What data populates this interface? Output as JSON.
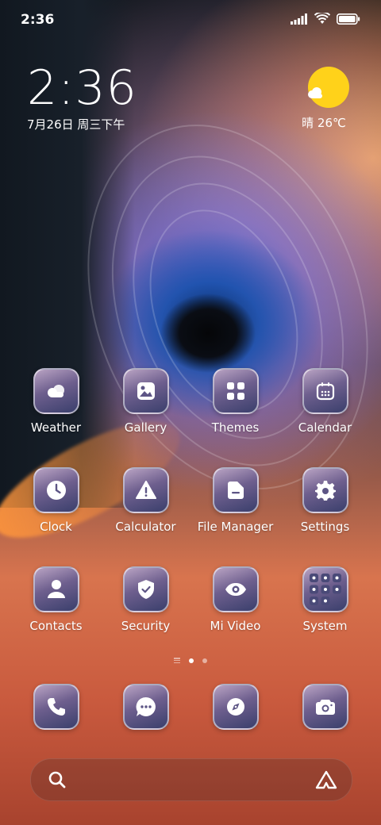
{
  "status_bar": {
    "time": "2:36",
    "icons": [
      "signal-icon",
      "wifi-icon",
      "battery-icon"
    ]
  },
  "clock_widget": {
    "time": "2:36",
    "date": "7月26日 周三下午"
  },
  "weather_widget": {
    "icon": "sun-cloud-icon",
    "text": "晴 26℃"
  },
  "apps": [
    {
      "label": "Weather",
      "icon": "weather-cloud-icon"
    },
    {
      "label": "Gallery",
      "icon": "gallery-icon"
    },
    {
      "label": "Themes",
      "icon": "themes-grid-icon"
    },
    {
      "label": "Calendar",
      "icon": "calendar-icon"
    },
    {
      "label": "Clock",
      "icon": "clock-icon"
    },
    {
      "label": "Calculator",
      "icon": "warning-triangle-icon"
    },
    {
      "label": "File Manager",
      "icon": "folder-icon"
    },
    {
      "label": "Settings",
      "icon": "gear-icon"
    },
    {
      "label": "Contacts",
      "icon": "contacts-icon"
    },
    {
      "label": "Security",
      "icon": "shield-check-icon"
    },
    {
      "label": "Mi Video",
      "icon": "eye-icon"
    },
    {
      "label": "System",
      "icon": "folder-grid-icon"
    }
  ],
  "pages": {
    "count": 2,
    "active": 1
  },
  "dock": [
    {
      "icon": "phone-icon"
    },
    {
      "icon": "message-icon"
    },
    {
      "icon": "compass-icon"
    },
    {
      "icon": "camera-icon"
    }
  ],
  "search_bar": {
    "left_icon": "search-icon",
    "right_icon": "assistant-logo-icon"
  },
  "colors": {
    "weather_sun": "#ffd21a",
    "icon_top": "#b9a3c3",
    "icon_bottom": "#3a3f6c"
  }
}
